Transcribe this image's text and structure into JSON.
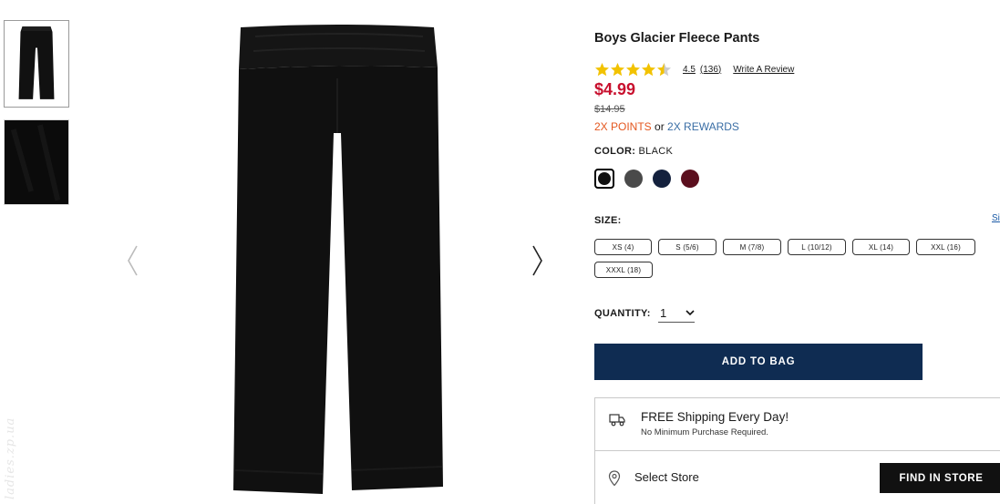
{
  "product": {
    "title": "Boys Glacier Fleece Pants",
    "rating": 4.5,
    "rating_display": "4.5",
    "review_count": "(136)",
    "write_review": "Write A Review",
    "price": "$4.99",
    "original_price": "$14.95",
    "points": "2X POINTS",
    "points_or": " or ",
    "rewards": "2X REWARDS"
  },
  "color": {
    "label": "COLOR:",
    "selected": "BLACK",
    "swatches": [
      {
        "name": "black",
        "hex": "#111111",
        "selected": true
      },
      {
        "name": "charcoal",
        "hex": "#4a4a4a",
        "selected": false
      },
      {
        "name": "navy",
        "hex": "#14213d",
        "selected": false
      },
      {
        "name": "burgundy",
        "hex": "#5b0f1e",
        "selected": false
      }
    ]
  },
  "size": {
    "label": "SIZE:",
    "guide_link": "Si",
    "options": [
      "XS (4)",
      "S (5/6)",
      "M (7/8)",
      "L (10/12)",
      "XL (14)",
      "XXL (16)",
      "XXXL (18)"
    ]
  },
  "quantity": {
    "label": "QUANTITY:",
    "value": "1"
  },
  "actions": {
    "add_to_bag": "ADD TO BAG",
    "find_in_store": "FIND IN STORE"
  },
  "shipping": {
    "title": "FREE Shipping Every Day!",
    "subtitle": "No Minimum Purchase Required."
  },
  "store": {
    "label": "Select Store"
  },
  "watermark": "ladies.zp.ua",
  "colors": {
    "price_red": "#c8102e",
    "points_orange": "#e4571f",
    "rewards_blue": "#3a6ea5",
    "add_button_navy": "#0f2c52",
    "star_gold": "#f2c200"
  }
}
